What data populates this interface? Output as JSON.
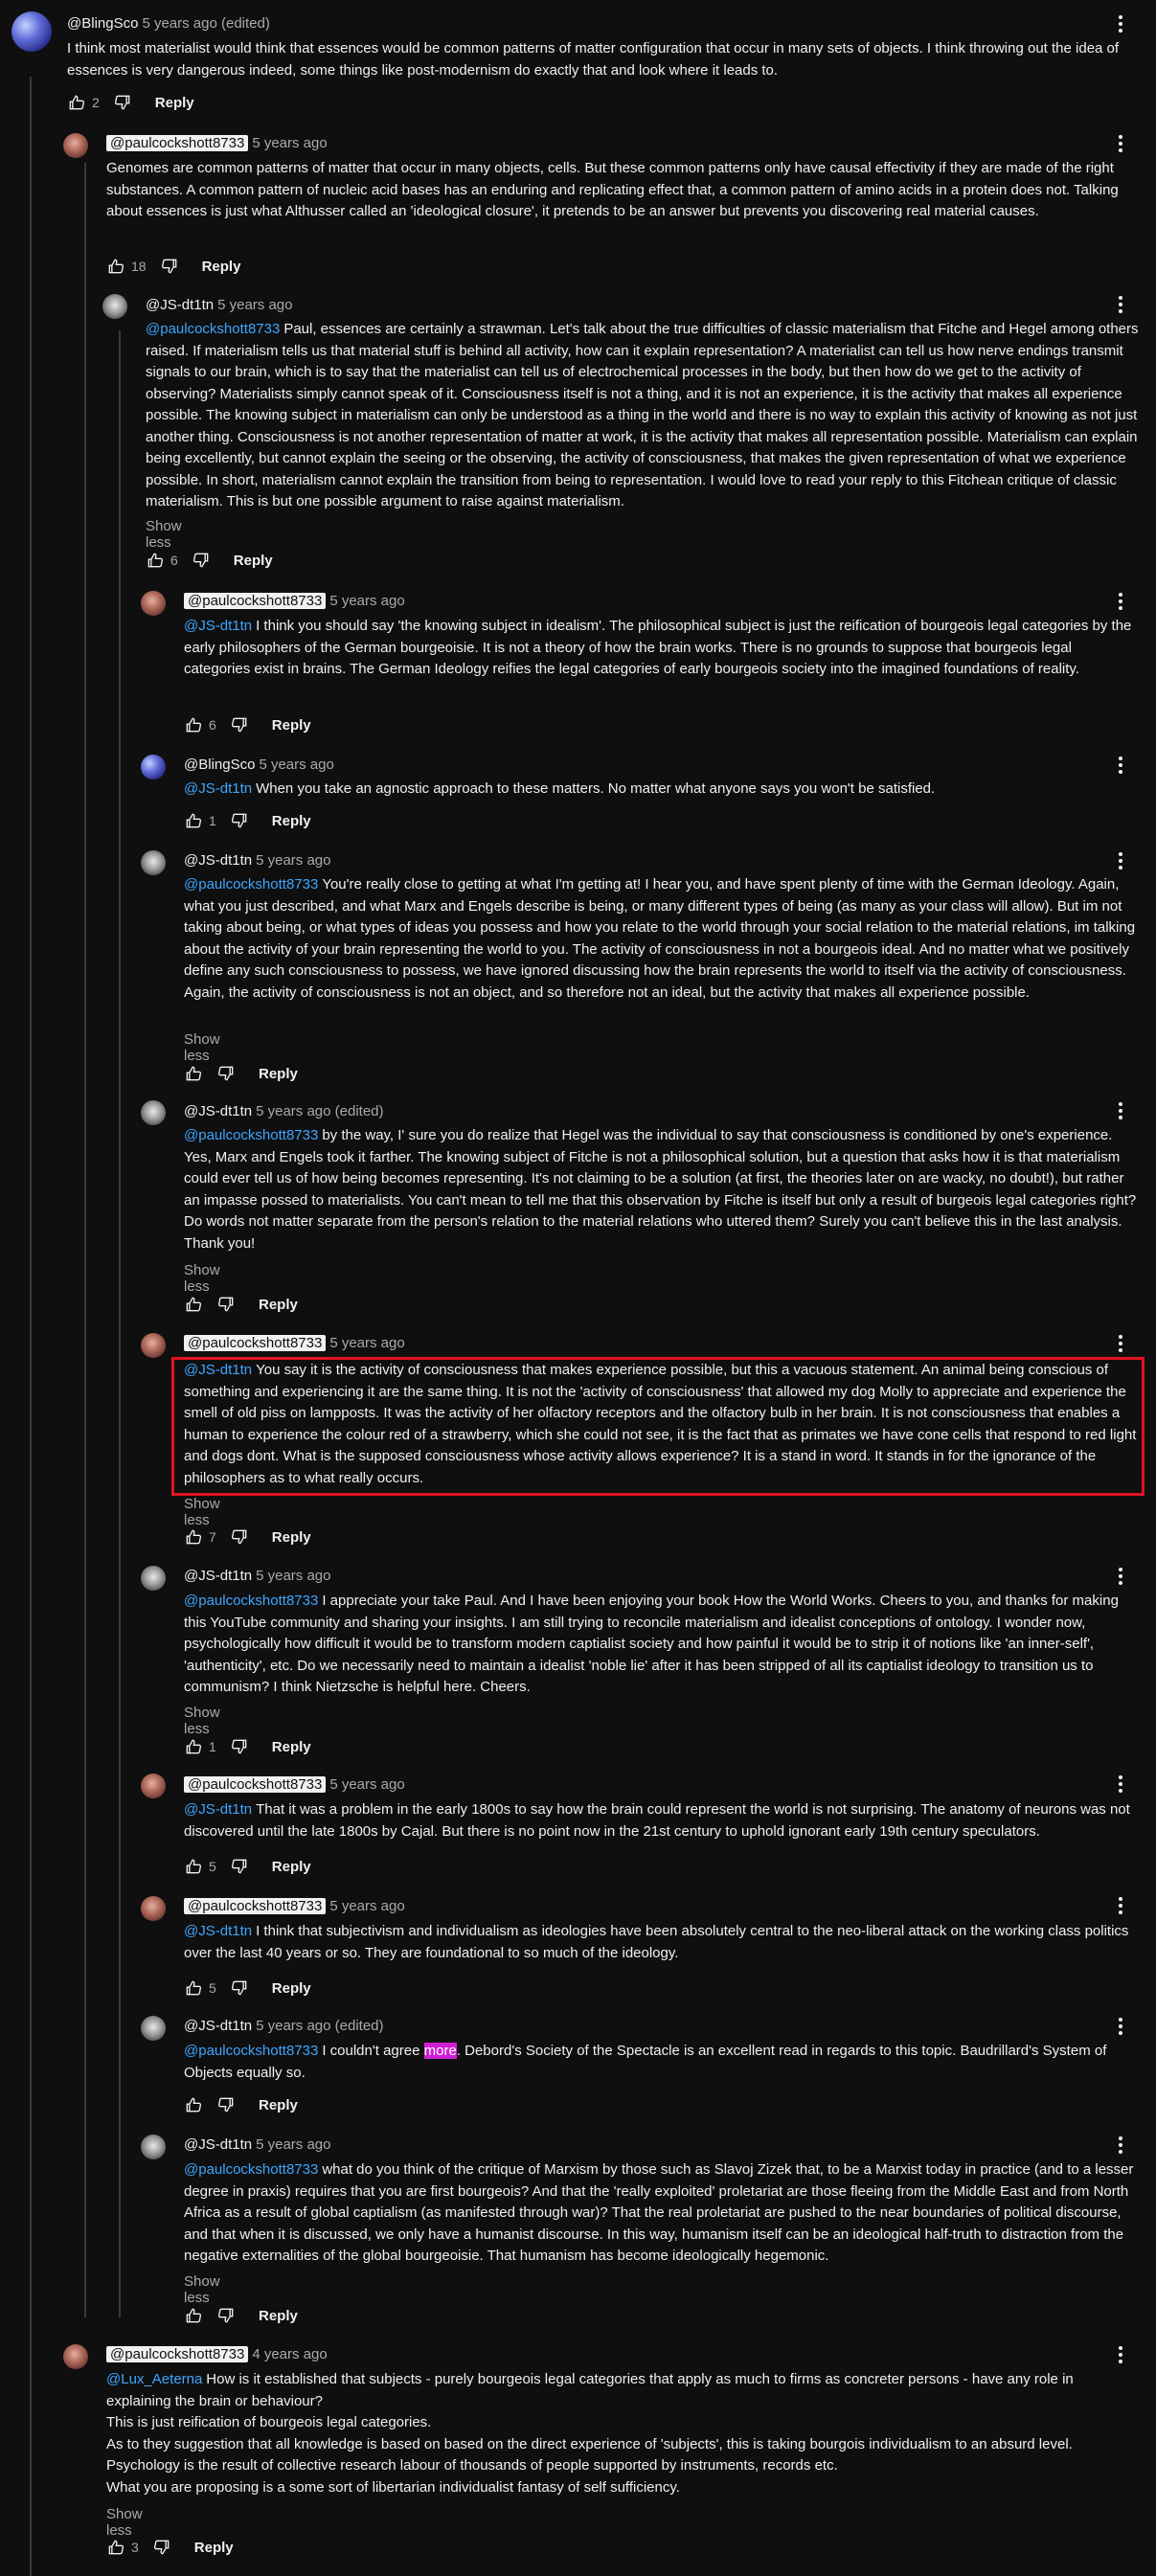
{
  "labels": {
    "show_less": "Show less",
    "reply": "Reply"
  },
  "comments": [
    {
      "author": "@BlingSco",
      "time": "5 years ago (edited)",
      "likes": "2",
      "text": "I think most materialist would think that essences would be common patterns of matter configuration that occur in many sets of objects. I think throwing out the idea of essences is very dangerous indeed, some things like post-modernism do exactly that and look where it leads to."
    },
    {
      "author": "@paulcockshott8733",
      "time": "5 years ago",
      "likes": "18",
      "text": "Genomes are common patterns of matter that occur in many objects, cells. But these common patterns only have causal effectivity if they are made of the right substances. A common pattern of nucleic acid bases has an enduring and replicating effect that, a common pattern of amino acids in a protein does not. Talking about essences is just what Althusser called an 'ideological closure', it pretends to be an answer but prevents you discovering real material causes."
    },
    {
      "author": "@JS-dt1tn",
      "time": "5 years ago",
      "likes": "6",
      "mention": "@paulcockshott8733",
      "text": "Paul, essences are certainly a strawman. Let's talk about the true difficulties of classic materialism that Fitche and Hegel among others raised. If materialism tells us that material stuff is behind all activity, how can it explain representation? A materialist can tell us how nerve endings transmit signals to our brain, which is to say that the materialist can tell us of electrochemical processes in the body, but then how do we get to the activity of observing? Materialists simply cannot speak of it. Consciousness itself is not a thing, and it is not an experience, it is the activity that makes all experience possible. The knowing subject in materialism can only be understood as a thing in the world and there is no way to explain this activity of knowing as not just another thing. Consciousness is not another representation of matter at work, it is the activity that makes all representation possible. Materialism can explain being excellently, but cannot explain the seeing or the observing, the activity of consciousness, that makes the given representation of what we experience possible. In short, materialism cannot explain the transition from being to representation. I would love to read your reply to this Fitchean critique of classic materialism. This is but one possible argument to raise against materialism."
    },
    {
      "author": "@paulcockshott8733",
      "time": "5 years ago",
      "likes": "6",
      "mention": "@JS-dt1tn",
      "text": "I think you should say 'the knowing subject in idealism'. The philosophical subject is just the reification of bourgeois legal categories by the early philosophers of the German bourgeoisie. It is not a theory of how the brain works. There is no grounds to suppose that bourgeois legal categories exist in brains. The German Ideology reifies the legal categories of early bourgeois society into the imagined foundations of reality."
    },
    {
      "author": "@BlingSco",
      "time": "5 years ago",
      "likes": "1",
      "mention": "@JS-dt1tn",
      "text": "When you take an agnostic approach to these matters. No matter what anyone says you won't be satisfied."
    },
    {
      "author": "@JS-dt1tn",
      "time": "5 years ago",
      "likes": "",
      "mention": "@paulcockshott8733",
      "text": "You're really close to getting at what I'm getting at! I hear you, and have spent plenty of time with the German Ideology. Again, what you just described, and what Marx and Engels describe is being, or many different types of being (as many as your class will allow). But im not taking about being, or what types of ideas you possess and how you relate to the world through your social relation to the material relations, im talking about the activity of your brain representing the world to you. The activity of consciousness in not a bourgeois  ideal. And no matter what we positively define any such consciousness to possess, we have ignored discussing how the brain represents the world to itself via the activity of consciousness. Again, the activity of consciousness is not an object, and so therefore not an ideal, but the activity that makes all experience possible."
    },
    {
      "author": "@JS-dt1tn",
      "time": "5 years ago (edited)",
      "likes": "",
      "mention": "@paulcockshott8733",
      "text": "by the way, I' sure you do realize that Hegel was the individual to say that consciousness is conditioned by one's experience. Yes, Marx and Engels took it farther. The knowing subject of Fitche is not a philosophical solution, but a question that asks how it is that materialism could ever tell us of how being becomes representing. It's not claiming to be a solution (at first, the theories later on are wacky, no doubt!), but rather an impasse possed to materialists. You can't mean to tell me that this observation by Fitche is itself but only a result of burgeois legal categories right? Do words not matter separate from the person's relation to the material relations who uttered them? Surely you can't believe this in the last analysis. Thank you!"
    },
    {
      "author": "@paulcockshott8733",
      "time": "5 years ago",
      "likes": "7",
      "mention": "@JS-dt1tn",
      "text": "You say it is the activity of consciousness that makes experience possible, but this a vacuous statement. An animal being conscious of something and experiencing it are the same thing. It is not the 'activity of consciousness' that allowed my dog Molly to appreciate and experience the smell of old piss on lampposts. It was the activity of her olfactory receptors and the olfactory bulb in her brain. It is not consciousness that enables a human to experience the colour red of a strawberry, which she could not see, it is the fact that as primates we have cone cells that respond to red light and dogs dont. What is the supposed consciousness whose activity allows experience? It is a stand in word. It stands in for the ignorance of the philosophers as to what really occurs."
    },
    {
      "author": "@JS-dt1tn",
      "time": "5 years ago",
      "likes": "1",
      "mention": "@paulcockshott8733",
      "text": "I appreciate your take Paul. And I have been enjoying your book How the World Works. Cheers to you, and thanks for making this YouTube community and sharing your insights. I am still trying to reconcile materialism and idealist conceptions of ontology. I wonder now, psychologically how difficult it would be to transform modern captialist society and how painful it would be to strip it of notions like 'an inner-self', 'authenticity', etc. Do we necessarily need to maintain a idealist 'noble lie' after it has been stripped of all its captialist ideology to transition us to communism? I think Nietzsche is helpful here. Cheers."
    },
    {
      "author": "@paulcockshott8733",
      "time": "5 years ago",
      "likes": "5",
      "mention": "@JS-dt1tn",
      "text": "That it was a problem in the early 1800s to say how the brain could represent the world is not surprising. The anatomy of neurons was not discovered until the late 1800s by Cajal. But there is no point now in the 21st century to uphold ignorant early 19th century speculators."
    },
    {
      "author": "@paulcockshott8733",
      "time": "5 years ago",
      "likes": "5",
      "mention": "@JS-dt1tn",
      "text": "I think that subjectivism and individualism as ideologies have been absolutely central to the neo-liberal attack on the working class politics over the last 40 years or so. They are foundational to so much of the ideology."
    },
    {
      "author": "@JS-dt1tn",
      "time": "5 years ago (edited)",
      "likes": "",
      "mention": "@paulcockshott8733",
      "text_a": "I couldn't agree ",
      "highlight": "more",
      "text_b": ". Debord's Society of the Spectacle is an excellent read in regards to this topic. Baudrillard's System of Objects equally so."
    },
    {
      "author": "@JS-dt1tn",
      "time": "5 years ago",
      "likes": "",
      "mention": "@paulcockshott8733",
      "text": "what do you think of the critique of Marxism by those such as Slavoj Zizek that, to be a Marxist today in practice (and to a lesser degree in praxis) requires that you are first bourgeois? And that the 'really exploited' proletariat are those fleeing from the Middle East and from North Africa as a result of global captialism (as manifested through war)? That the real proletariat are pushed to the near boundaries of political discourse, and that when it is discussed, we only have a humanist discourse. In this way, humanism itself can be an ideological half-truth to distraction from the negative externalities of the global bourgeoisie. That humanism has become ideologically hegemonic."
    },
    {
      "author": "@paulcockshott8733",
      "time": "4 years ago",
      "likes": "3",
      "mention": "@Lux_Aeterna",
      "lines": [
        "How is it established that subjects - purely bourgeois legal categories that apply as much to firms as concreter persons - have any role in explaining the brain or behaviour?",
        "This is just reification of bourgeois legal categories.",
        "As to they suggestion that all knowledge is based on based on the direct experience of 'subjects', this is taking bourgois individualism to an absurd level.",
        "Psychology is the result of collective research labour of thousands of people supported by instruments, records etc.",
        "What you are proposing is a some sort of libertarian individualist fantasy of self sufficiency."
      ]
    }
  ]
}
